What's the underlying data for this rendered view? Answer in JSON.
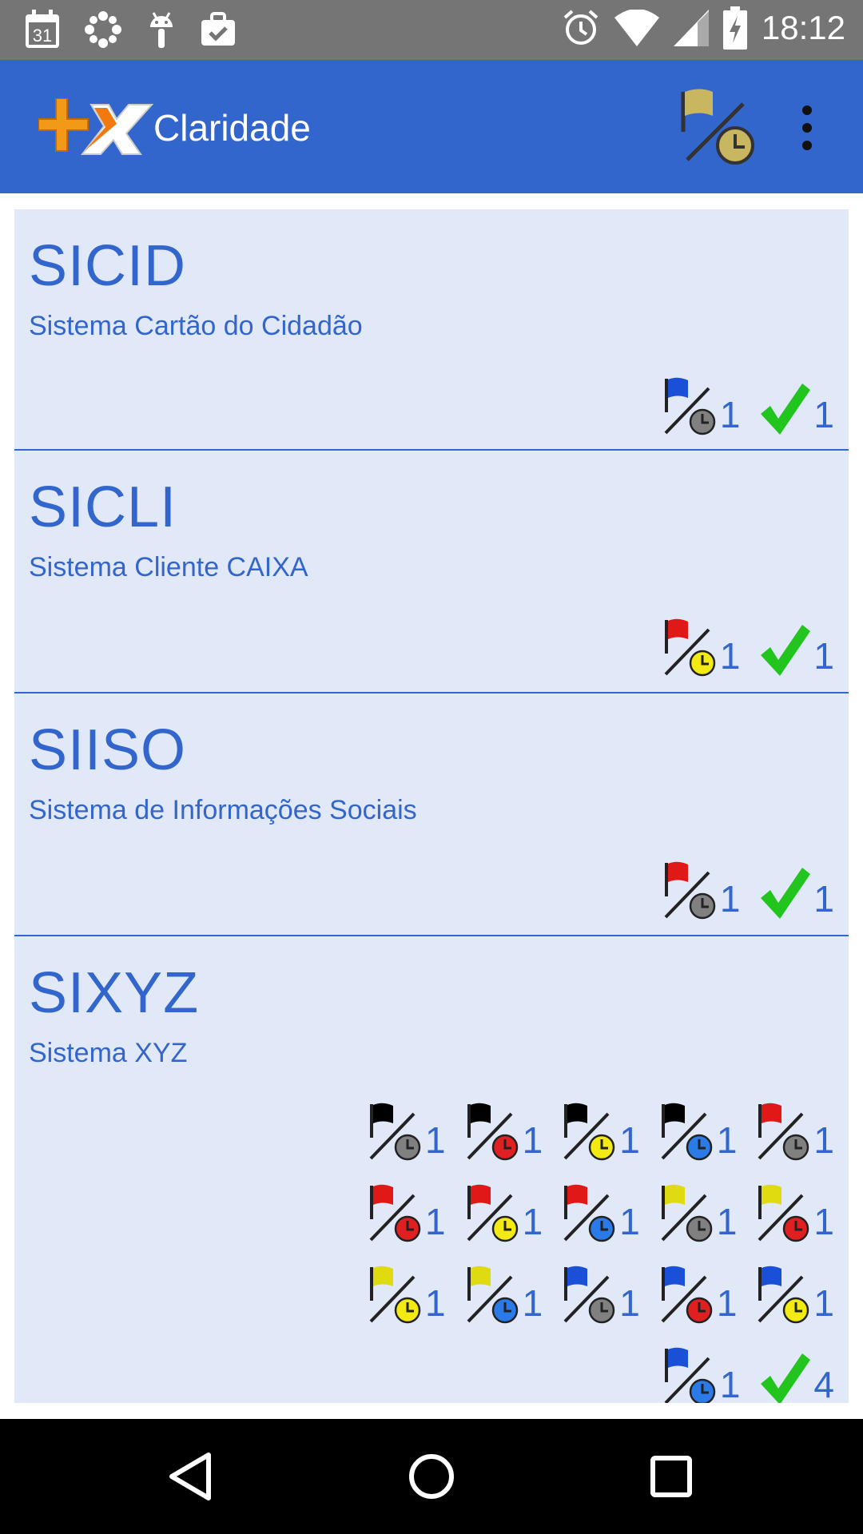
{
  "status_bar": {
    "time": "18:12",
    "calendar_day": "31",
    "icons": [
      "calendar-icon",
      "dots-icon",
      "android-icon",
      "briefcase-check-icon",
      "alarm-icon",
      "wifi-icon",
      "signal-icon",
      "battery-charging-icon"
    ]
  },
  "app_bar": {
    "title": "Claridade",
    "logo": "plus-x-logo",
    "filter_icon": "flag-clock-icon",
    "menu_icon": "overflow-menu-icon"
  },
  "colors": {
    "primary": "#3366CC",
    "card_bg": "#E1E8F8",
    "status_bar": "#757575",
    "check": "#22C41E",
    "flag_blue": "#1A4FD8",
    "flag_red": "#E01818",
    "flag_black": "#000000",
    "flag_yellow": "#E0DB10",
    "clock_gray": "#808080",
    "clock_red": "#E02020",
    "clock_yellow": "#F2EA12",
    "clock_blue": "#2A7BE8"
  },
  "systems": [
    {
      "code": "SICID",
      "name": "Sistema Cartão do Cidadão",
      "badges": [
        {
          "flag": "blue",
          "clock": "gray",
          "count": "1"
        },
        {
          "check": true,
          "count": "1"
        }
      ]
    },
    {
      "code": "SICLI",
      "name": "Sistema Cliente CAIXA",
      "badges": [
        {
          "flag": "red",
          "clock": "yellow",
          "count": "1"
        },
        {
          "check": true,
          "count": "1"
        }
      ]
    },
    {
      "code": "SIISO",
      "name": "Sistema de Informações Sociais",
      "badges": [
        {
          "flag": "red",
          "clock": "gray",
          "count": "1"
        },
        {
          "check": true,
          "count": "1"
        }
      ]
    },
    {
      "code": "SIXYZ",
      "name": "Sistema XYZ",
      "badges": [
        {
          "flag": "black",
          "clock": "gray",
          "count": "1"
        },
        {
          "flag": "black",
          "clock": "red",
          "count": "1"
        },
        {
          "flag": "black",
          "clock": "yellow",
          "count": "1"
        },
        {
          "flag": "black",
          "clock": "blue",
          "count": "1"
        },
        {
          "flag": "red",
          "clock": "gray",
          "count": "1"
        },
        {
          "flag": "red",
          "clock": "red",
          "count": "1"
        },
        {
          "flag": "red",
          "clock": "yellow",
          "count": "1"
        },
        {
          "flag": "red",
          "clock": "blue",
          "count": "1"
        },
        {
          "flag": "yellow",
          "clock": "gray",
          "count": "1"
        },
        {
          "flag": "yellow",
          "clock": "red",
          "count": "1"
        },
        {
          "flag": "yellow",
          "clock": "yellow",
          "count": "1"
        },
        {
          "flag": "yellow",
          "clock": "blue",
          "count": "1"
        },
        {
          "flag": "blue",
          "clock": "gray",
          "count": "1"
        },
        {
          "flag": "blue",
          "clock": "red",
          "count": "1"
        },
        {
          "flag": "blue",
          "clock": "yellow",
          "count": "1"
        },
        {
          "flag": "blue",
          "clock": "blue",
          "count": "1"
        },
        {
          "check": true,
          "count": "4"
        }
      ]
    }
  ],
  "nav_bar": {
    "back": "back-icon",
    "home": "home-icon",
    "recents": "recents-icon"
  }
}
